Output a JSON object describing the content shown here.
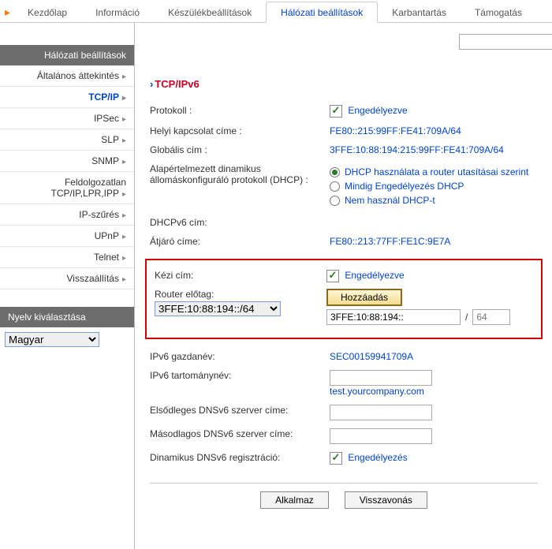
{
  "topnav": {
    "items": [
      {
        "label": "Kezdőlap"
      },
      {
        "label": "Információ"
      },
      {
        "label": "Készülékbeállítások"
      },
      {
        "label": "Hálózati beállítások",
        "active": true
      },
      {
        "label": "Karbantartás"
      },
      {
        "label": "Támogatás"
      }
    ]
  },
  "sidebar": {
    "group_title": "Hálózati beállítások",
    "items": [
      {
        "label": "Általános áttekintés"
      },
      {
        "label": "TCP/IP",
        "active": true
      },
      {
        "label": "IPSec"
      },
      {
        "label": "SLP"
      },
      {
        "label": "SNMP"
      },
      {
        "label": "Feldolgozatlan TCP/IP,LPR,IPP"
      },
      {
        "label": "IP-szűrés"
      },
      {
        "label": "UPnP"
      },
      {
        "label": "Telnet"
      },
      {
        "label": "Visszaállítás"
      }
    ],
    "lang_title": "Nyelv kiválasztása",
    "lang_value": "Magyar"
  },
  "section_title": "TCP/IPv6",
  "rows": {
    "protocol_label": "Protokoll :",
    "protocol_value": "Engedélyezve",
    "local_addr_label": "Helyi kapcsolat címe :",
    "local_addr_value": "FE80::215:99FF:FE41:709A/64",
    "global_addr_label": "Globális cím :",
    "global_addr_value": "3FFE:10:88:194:215:99FF:FE41:709A/64",
    "dhcp_default_label": "Alapértelmezett dinamikus állomáskonfiguráló protokoll (DHCP) :",
    "dhcp_options": [
      {
        "label": "DHCP használata a router utasításai szerint",
        "selected": true
      },
      {
        "label": "Mindig Engedélyezés DHCP",
        "selected": false
      },
      {
        "label": "Nem használ DHCP-t",
        "selected": false
      }
    ],
    "dhcpv6_addr_label": "DHCPv6 cím:",
    "gateway_label": "Átjáró címe:",
    "gateway_value": "FE80::213:77FF:FE1C:9E7A",
    "manual_label": "Kézi cím:",
    "manual_value": "Engedélyezve",
    "router_prefix_label": "Router előtag:",
    "router_prefix_value": "3FFE:10:88:194::/64",
    "add_button": "Hozzáadás",
    "manual_input_value": "3FFE:10:88:194::",
    "manual_prefix_placeholder": "64",
    "hostname_label": "IPv6 gazdanév:",
    "hostname_value": "SEC00159941709A",
    "domain_label": "IPv6 tartománynév:",
    "domain_link": "test.yourcompany.com",
    "dns1_label": "Elsődleges DNSv6 szerver címe:",
    "dns2_label": "Másodlagos DNSv6 szerver címe:",
    "dyn_dns_label": "Dinamikus DNSv6 regisztráció:",
    "dyn_dns_value": "Engedélyezés"
  },
  "footer": {
    "apply": "Alkalmaz",
    "cancel": "Visszavonás"
  }
}
